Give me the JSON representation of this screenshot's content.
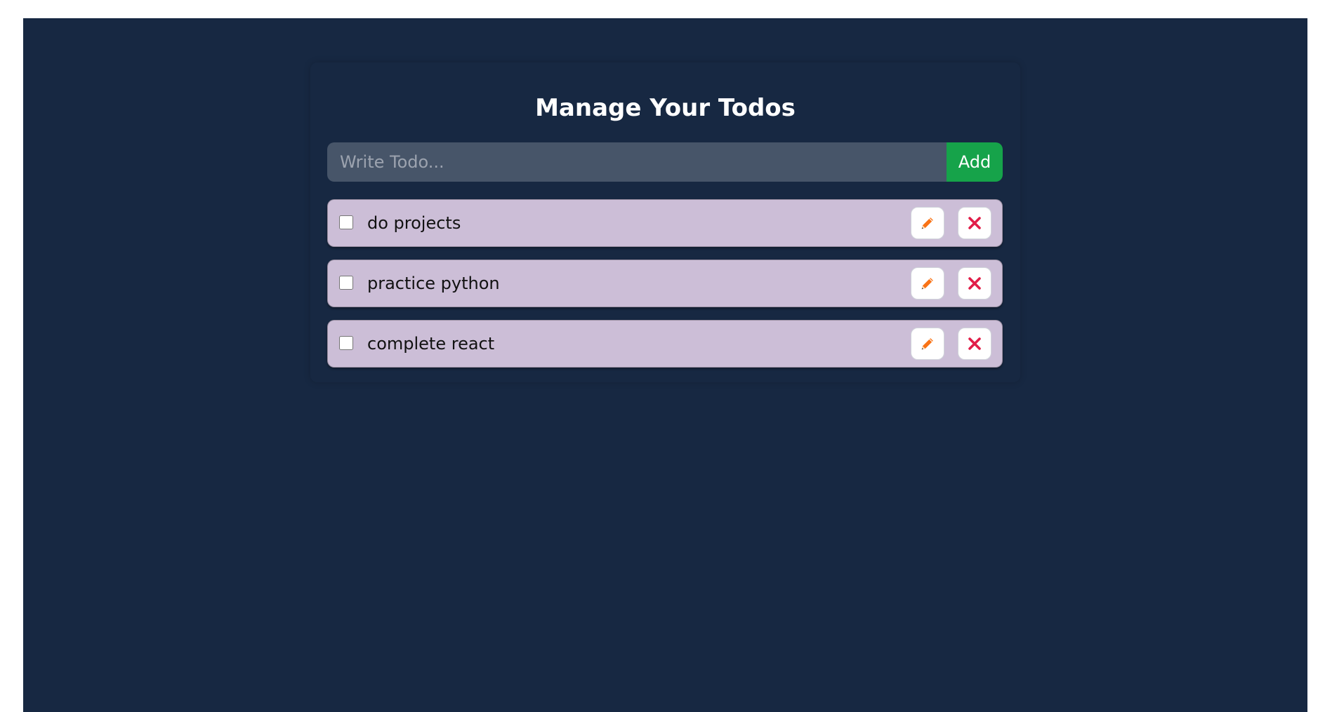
{
  "header": {
    "title": "Manage Your Todos"
  },
  "add_form": {
    "input_value": "",
    "input_placeholder": "Write Todo...",
    "add_label": "Add"
  },
  "todos": [
    {
      "text": "do projects",
      "completed": false
    },
    {
      "text": "practice python",
      "completed": false
    },
    {
      "text": "complete react",
      "completed": false
    }
  ],
  "icons": {
    "edit": "pencil-icon",
    "delete": "close-icon"
  },
  "colors": {
    "background": "#172842",
    "input_background": "#475569",
    "add_button": "#16a34a",
    "todo_item": "#ccbed7",
    "edit_icon": "#f97316",
    "delete_icon": "#e11d48"
  }
}
